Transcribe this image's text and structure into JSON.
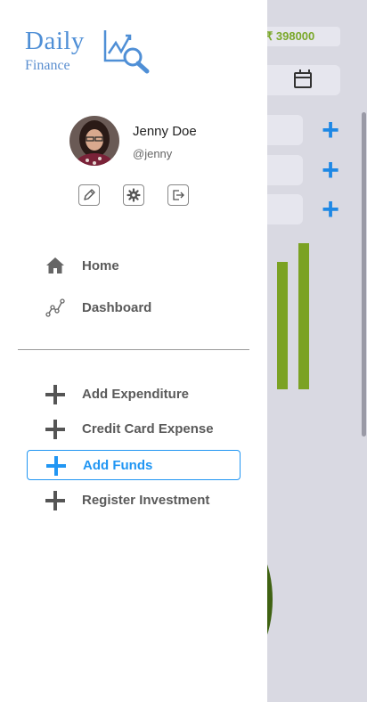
{
  "app": {
    "logo_line1": "Daily",
    "logo_line2": "Finance"
  },
  "user": {
    "name": "Jenny Doe",
    "handle": "@jenny"
  },
  "profile_actions": [
    {
      "icon": "pencil-icon"
    },
    {
      "icon": "gear-icon"
    },
    {
      "icon": "logout-icon"
    }
  ],
  "nav": [
    {
      "label": "Home",
      "icon": "home-icon"
    },
    {
      "label": "Dashboard",
      "icon": "chart-line-icon"
    }
  ],
  "actions": [
    {
      "label": "Add Expenditure"
    },
    {
      "label": "Credit Card Expense"
    },
    {
      "label": "Add Funds",
      "active": true
    },
    {
      "label": "Register Investment"
    }
  ],
  "background": {
    "amount": "₹ 398000"
  },
  "colors": {
    "accent": "#2196f3",
    "logo": "#4f8fd6",
    "bar": "#7ba223",
    "amount": "#7aa82a"
  }
}
